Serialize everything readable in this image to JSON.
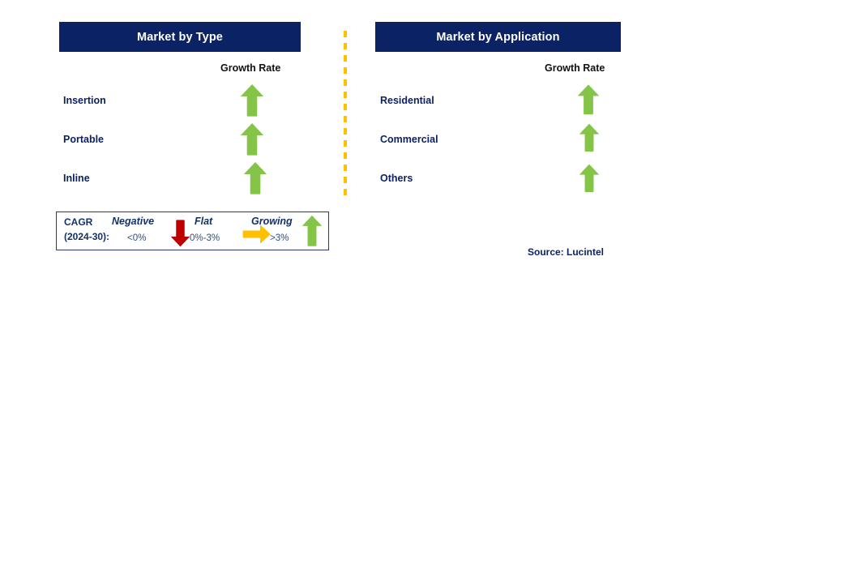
{
  "panels": [
    {
      "id": "type",
      "title": "Market by Type",
      "growth_rate_label": "Growth Rate",
      "rows": [
        {
          "label": "Insertion",
          "trend": "growing",
          "arrow": "up-arrow-icon"
        },
        {
          "label": "Portable",
          "trend": "growing",
          "arrow": "up-arrow-icon"
        },
        {
          "label": "Inline",
          "trend": "growing",
          "arrow": "up-arrow-icon"
        }
      ]
    },
    {
      "id": "application",
      "title": "Market by Application",
      "growth_rate_label": "Growth Rate",
      "rows": [
        {
          "label": "Residential",
          "trend": "growing",
          "arrow": "up-arrow-icon"
        },
        {
          "label": "Commercial",
          "trend": "growing",
          "arrow": "up-arrow-icon"
        },
        {
          "label": "Others",
          "trend": "growing",
          "arrow": "up-arrow-icon"
        }
      ]
    }
  ],
  "legend": {
    "cagr_line1": "CAGR",
    "cagr_line2": "(2024-30):",
    "items": [
      {
        "term": "Negative",
        "range": "<0%",
        "arrow": "down-arrow-icon",
        "color": "#C00000"
      },
      {
        "term": "Flat",
        "range": "0%-3%",
        "arrow": "right-arrow-icon",
        "color": "#FFC000"
      },
      {
        "term": "Growing",
        "range": ">3%",
        "arrow": "up-arrow-icon",
        "color": "#84C446"
      }
    ]
  },
  "source": "Source: Lucintel",
  "colors": {
    "header_navy": "#0b2265",
    "label_navy": "#0b2265",
    "arrow_green": "#84C446",
    "arrow_red": "#C00000",
    "arrow_amber": "#FFC000",
    "divider_amber": "#FFC000"
  }
}
